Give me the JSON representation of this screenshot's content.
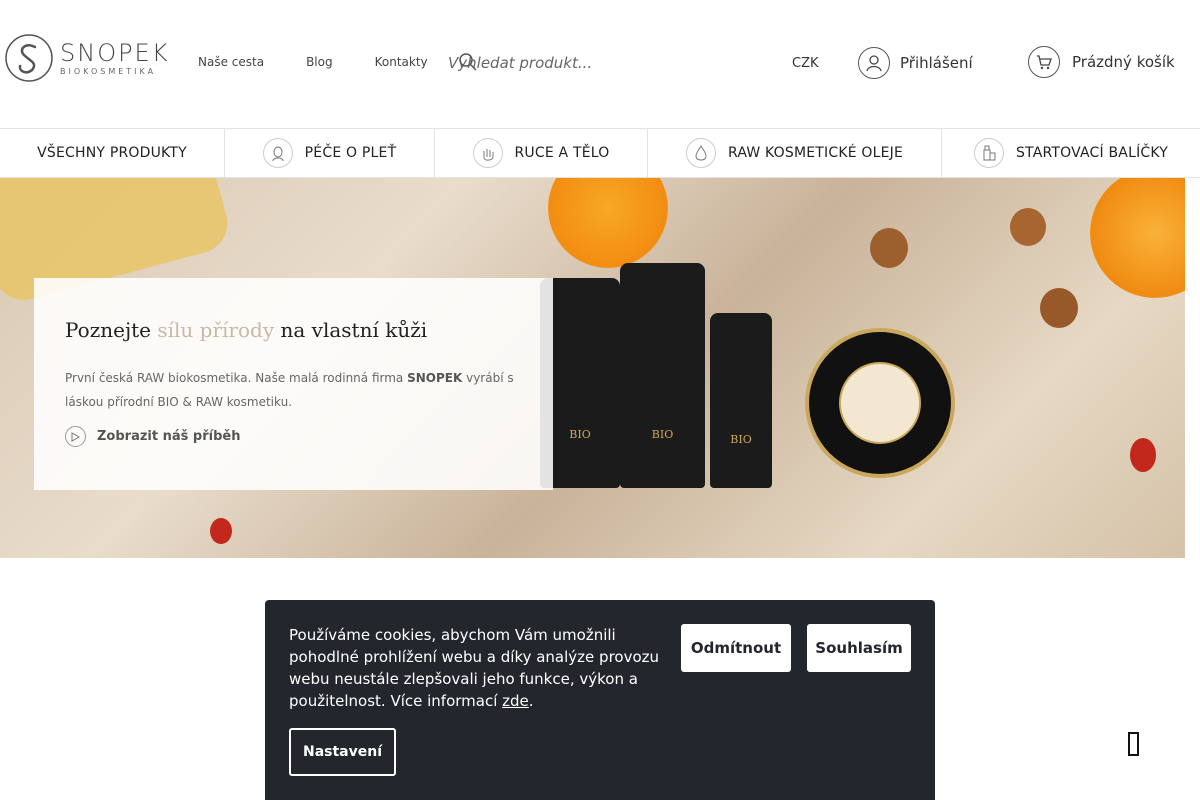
{
  "brand": {
    "name": "SNOPEK",
    "sub": "BIOKOSMETIKA"
  },
  "nav": {
    "items": [
      "Naše cesta",
      "Blog",
      "Kontakty"
    ]
  },
  "search": {
    "placeholder": "Vyhledat produkt..."
  },
  "header": {
    "currency": "CZK",
    "login_label": "Přihlášení",
    "cart_label": "Prázdný košík"
  },
  "categories": [
    {
      "label": "VŠECHNY PRODUKTY",
      "icon": "none"
    },
    {
      "label": "PÉČE O PLEŤ",
      "icon": "face-icon"
    },
    {
      "label": "RUCE A TĚLO",
      "icon": "hand-icon"
    },
    {
      "label": "RAW KOSMETICKÉ OLEJE",
      "icon": "drop-icon"
    },
    {
      "label": "STARTOVACÍ BALÍČKY",
      "icon": "package-icon"
    }
  ],
  "hero": {
    "title_pre": "Poznejte ",
    "title_accent": "sílu přírody",
    "title_post": " na vlastní kůži",
    "text_pre": "První česká RAW biokosmetika. Naše malá rodinná firma ",
    "text_bold": "SNOPEK",
    "text_post": " vyrábí s láskou přírodní BIO & RAW kosmetiku.",
    "link_label": "Zobrazit náš příběh",
    "bottle_labels": [
      "BIO",
      "BIO",
      "BIO"
    ]
  },
  "cookie": {
    "text": "Používáme cookies, abychom Vám umožnili pohodlné prohlížení webu a díky analýze provozu webu neustále zlepšovali jeho funkce, výkon a použitelnost. Více informací ",
    "link": "zde",
    "text_end": ".",
    "reject_label": "Odmítnout",
    "accept_label": "Souhlasím",
    "settings_label": "Nastavení"
  },
  "colors": {
    "accent": "#c8b8a4",
    "cookie_bg": "#24262d",
    "gold": "#c9a85c"
  }
}
